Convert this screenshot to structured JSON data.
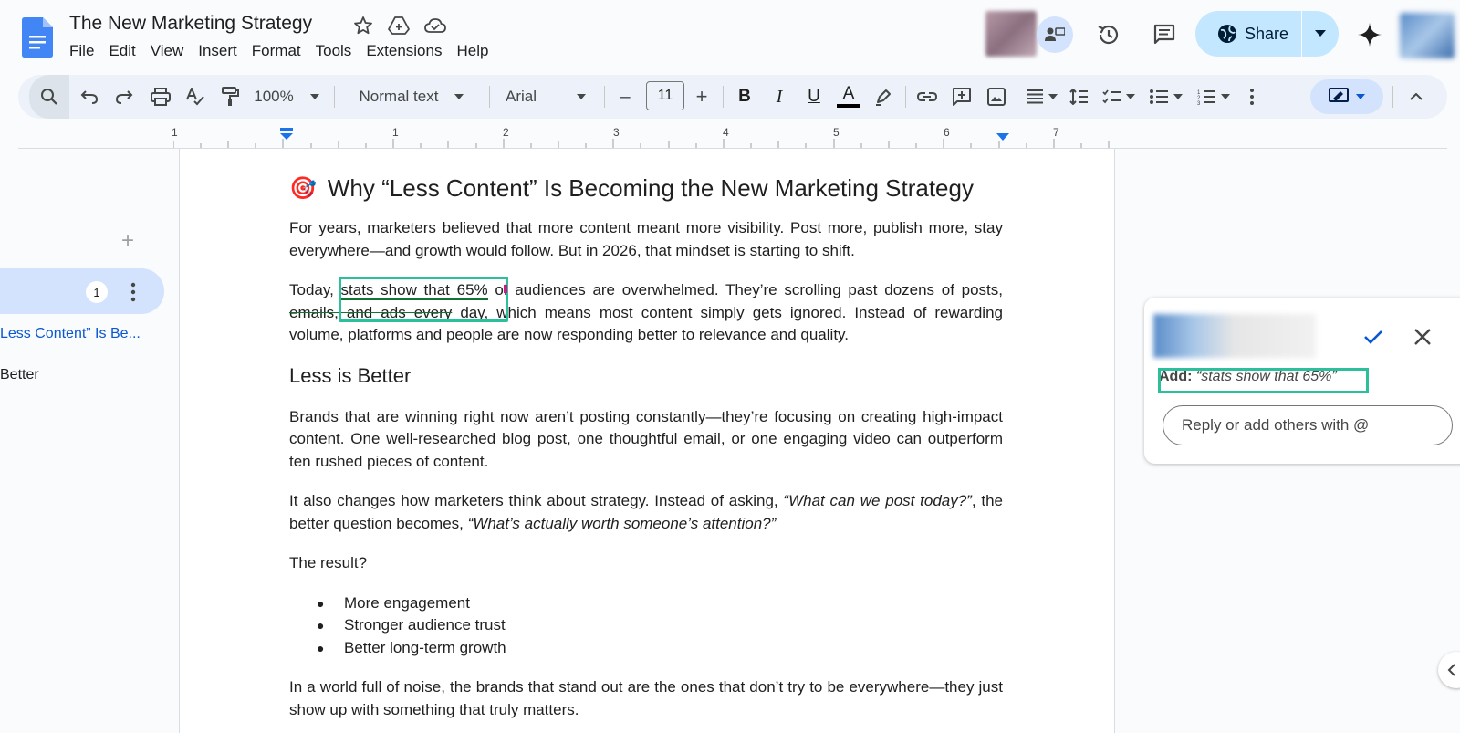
{
  "app": {
    "title": "The New Marketing Strategy",
    "menus": [
      "File",
      "Edit",
      "View",
      "Insert",
      "Format",
      "Tools",
      "Extensions",
      "Help"
    ],
    "share_label": "Share",
    "colors": {
      "accent": "#0b57d0",
      "share_bg": "#c2e7ff",
      "toolbar_bg": "#edf2fa",
      "suggestion_box": "#2bbf9c",
      "suggestion_green": "#137333"
    }
  },
  "toolbar": {
    "zoom": "100%",
    "style": "Normal text",
    "font": "Arial",
    "font_size": "11",
    "minus": "–",
    "plus": "+",
    "bold": "B",
    "italic": "I",
    "underline": "U",
    "text_color": "A"
  },
  "ruler": {
    "numbers": [
      "1",
      "1",
      "2",
      "3",
      "4",
      "5",
      "6",
      "7"
    ]
  },
  "outline": {
    "count": "1",
    "add": "+",
    "headings": [
      "Less Content” Is Be...",
      "Better"
    ]
  },
  "document": {
    "heading_emoji": "🎯",
    "heading": "Why “Less Content” Is Becoming the New Marketing Strategy",
    "p1": "For years, marketers believed that more content meant more visibility. Post more, publish more, stay everywhere—and growth would follow. But in 2026, that mindset is starting to shift.",
    "p2_start": "Today, ",
    "p2_insert": "stats show that 65%",
    "p2_mid1": " of audiences are overwhelmed. They’re scrolling past dozens of posts, ",
    "p2_strike": "emails, and ads every",
    "p2_end": " day, which means most content simply gets ignored. Instead of rewarding volume, platforms and people are now responding better to relevance and quality.",
    "h2": "Less is Better",
    "p3": "Brands that are winning right now aren’t posting constantly—they’re focusing on creating high-impact content. One well-researched blog post, one thoughtful email, or one engaging video can outperform ten rushed pieces of content.",
    "p4_start": "It also changes how marketers think about strategy. Instead of asking, ",
    "p4_q1": "“What can we post today?”",
    "p4_mid": ", the better question becomes, ",
    "p4_q2": "“What’s actually worth someone’s attention?”",
    "p5": "The result?",
    "bullets": [
      "More engagement",
      "Stronger audience trust",
      "Better long-term growth"
    ],
    "p6": "In a world full of noise, the brands that stand out are the ones that don’t try to be everywhere—they just show up with something that truly matters."
  },
  "comment": {
    "action_label": "Add:",
    "suggested_text": "“stats show that 65%”",
    "reply_placeholder": "Reply or add others with @"
  }
}
